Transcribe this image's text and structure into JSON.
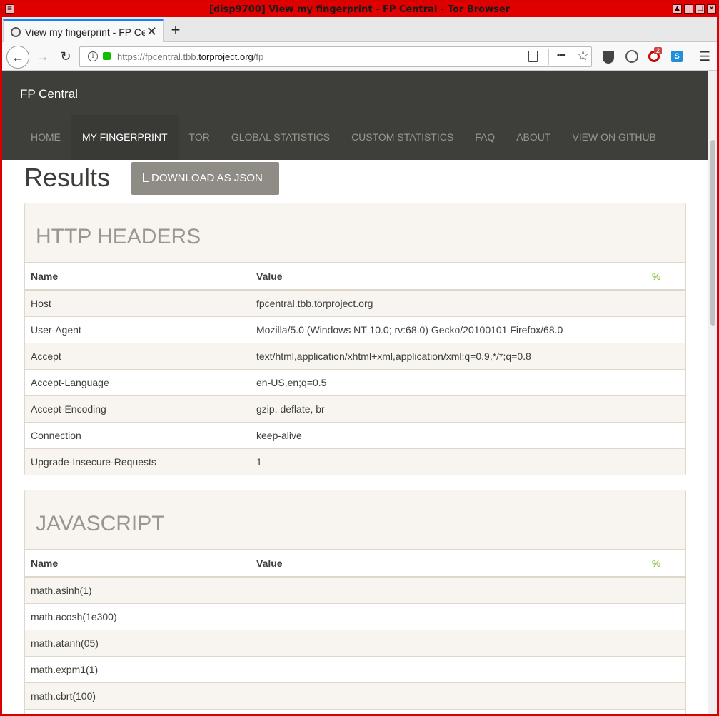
{
  "window": {
    "title": "[disp9700] View my fingerprint - FP Central - Tor Browser"
  },
  "tab": {
    "title": "View my fingerprint - FP Central",
    "close": "✕"
  },
  "newtab": "+",
  "nav": {
    "back": "←",
    "forward": "→",
    "reload": "↻",
    "info": "i"
  },
  "url": {
    "prefix": "https://fpcentral.tbb.",
    "domain": "torproject.org",
    "path": "/fp"
  },
  "toolbar": {
    "menu": "☰",
    "more": "•••",
    "star": "☆",
    "badge": "2"
  },
  "site": {
    "brand": "FP Central",
    "menu": [
      "HOME",
      "MY FINGERPRINT",
      "TOR",
      "GLOBAL STATISTICS",
      "CUSTOM STATISTICS",
      "FAQ",
      "ABOUT",
      "VIEW ON GITHUB"
    ]
  },
  "results": {
    "title": "Results",
    "download": "DOWNLOAD AS JSON"
  },
  "headers_panel": {
    "title": "HTTP HEADERS",
    "cols": [
      "Name",
      "Value",
      "%"
    ],
    "rows": [
      [
        "Host",
        "fpcentral.tbb.torproject.org"
      ],
      [
        "User-Agent",
        "Mozilla/5.0 (Windows NT 10.0; rv:68.0) Gecko/20100101 Firefox/68.0"
      ],
      [
        "Accept",
        "text/html,application/xhtml+xml,application/xml;q=0.9,*/*;q=0.8"
      ],
      [
        "Accept-Language",
        "en-US,en;q=0.5"
      ],
      [
        "Accept-Encoding",
        "gzip, deflate, br"
      ],
      [
        "Connection",
        "keep-alive"
      ],
      [
        "Upgrade-Insecure-Requests",
        "1"
      ]
    ]
  },
  "js_panel": {
    "title": "JAVASCRIPT",
    "cols": [
      "Name",
      "Value",
      "%"
    ],
    "rows": [
      [
        "math.asinh(1)",
        ""
      ],
      [
        "math.acosh(1e300)",
        ""
      ],
      [
        "math.atanh(05)",
        ""
      ],
      [
        "math.expm1(1)",
        ""
      ],
      [
        "math.cbrt(100)",
        ""
      ]
    ]
  }
}
